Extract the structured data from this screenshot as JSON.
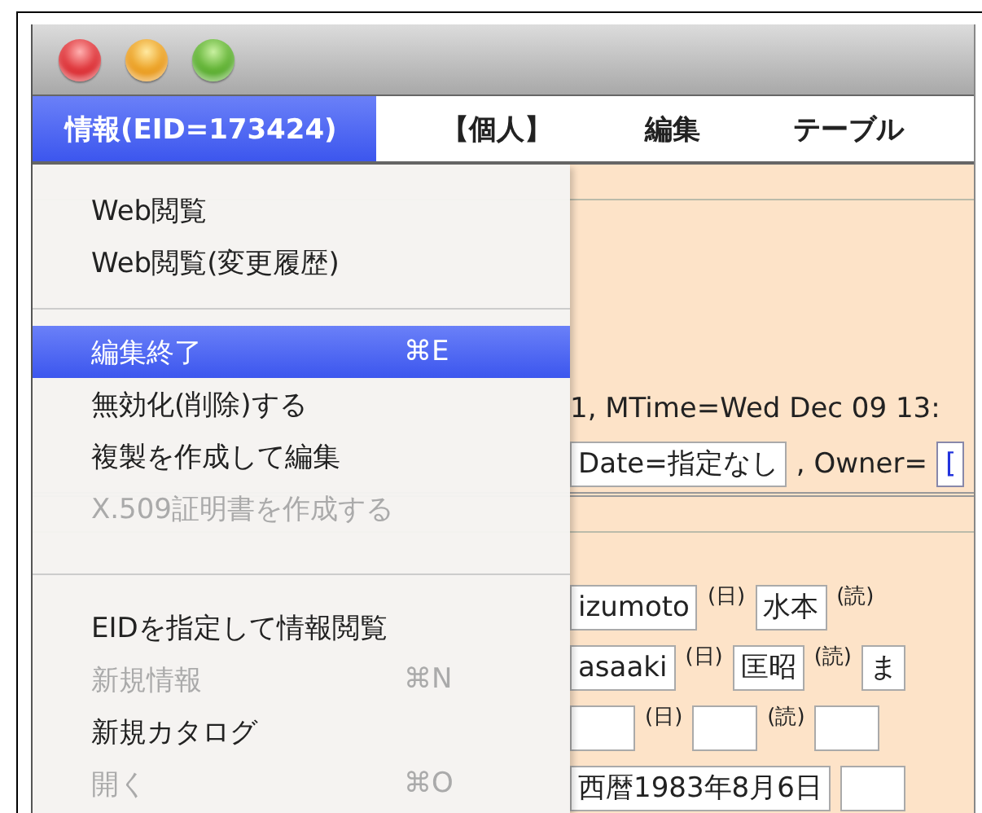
{
  "window": {
    "controls": [
      {
        "kind": "close"
      },
      {
        "kind": "minimize"
      },
      {
        "kind": "zoom"
      }
    ]
  },
  "menubar": [
    {
      "label": "情報(EID=173424)",
      "selected": true
    },
    {
      "label": "【個人】",
      "selected": false
    },
    {
      "label": "編集",
      "selected": false
    },
    {
      "label": "テーブル",
      "selected": false
    }
  ],
  "menu": [
    {
      "kind": "item",
      "label": "Web閲覧",
      "disabled": false,
      "selected": false
    },
    {
      "kind": "item",
      "label": "Web閲覧(変更履歴)",
      "disabled": false,
      "selected": false
    },
    {
      "kind": "separator"
    },
    {
      "kind": "item",
      "label": "編集終了",
      "shortcut": "⌘E",
      "disabled": false,
      "selected": true
    },
    {
      "kind": "item",
      "label": "無効化(削除)する",
      "disabled": false,
      "selected": false
    },
    {
      "kind": "item",
      "label": "複製を作成して編集",
      "disabled": false,
      "selected": false
    },
    {
      "kind": "item",
      "label": "X.509証明書を作成する",
      "disabled": true,
      "selected": false
    },
    {
      "kind": "separator"
    },
    {
      "kind": "item",
      "label": "EIDを指定して情報閲覧",
      "disabled": false,
      "selected": false
    },
    {
      "kind": "item",
      "label": "新規情報",
      "shortcut": "⌘N",
      "disabled": true,
      "selected": false
    },
    {
      "kind": "item",
      "label": "新規カタログ",
      "disabled": false,
      "selected": false
    },
    {
      "kind": "item",
      "label": "開く",
      "shortcut": "⌘O",
      "disabled": true,
      "selected": false
    }
  ],
  "record": {
    "lines": [
      [
        {
          "kind": "text",
          "text": "1, MTime=Wed Dec 09 13:"
        }
      ],
      [
        {
          "kind": "field",
          "text": "Date=指定なし"
        },
        {
          "kind": "text",
          "text": ", Owner="
        },
        {
          "kind": "link",
          "text": "["
        }
      ]
    ]
  },
  "name_rows": [
    [
      {
        "kind": "field",
        "text": "izumoto"
      },
      {
        "kind": "note",
        "text": "(日)"
      },
      {
        "kind": "field",
        "text": "水本"
      },
      {
        "kind": "note",
        "text": "(読)"
      }
    ],
    [
      {
        "kind": "field",
        "text": "asaaki"
      },
      {
        "kind": "note",
        "text": "(日)"
      },
      {
        "kind": "field",
        "text": "匡昭"
      },
      {
        "kind": "note",
        "text": "(読)"
      },
      {
        "kind": "field",
        "text": "ま"
      }
    ],
    [
      {
        "kind": "field"
      },
      {
        "kind": "note",
        "text": "(日)"
      },
      {
        "kind": "field"
      },
      {
        "kind": "note",
        "text": "(読)"
      },
      {
        "kind": "field"
      }
    ],
    [
      {
        "kind": "field",
        "text": "西暦1983年8月6日"
      },
      {
        "kind": "field"
      }
    ]
  ]
}
